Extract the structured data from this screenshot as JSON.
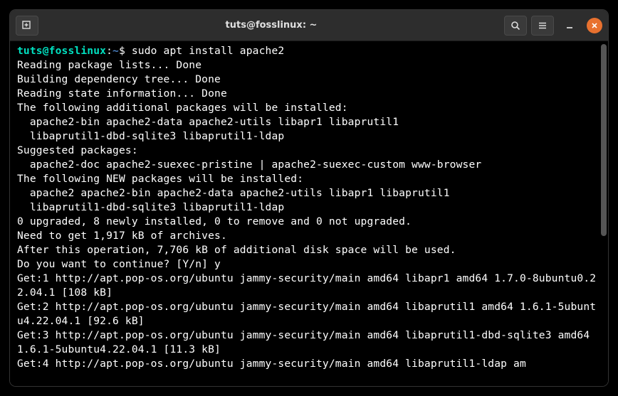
{
  "titlebar": {
    "title": "tuts@fosslinux: ~"
  },
  "prompt": {
    "user_host": "tuts@fosslinux",
    "colon": ":",
    "path": "~",
    "dollar": "$ "
  },
  "command": "sudo apt install apache2",
  "output": "Reading package lists... Done\nBuilding dependency tree... Done\nReading state information... Done\nThe following additional packages will be installed:\n  apache2-bin apache2-data apache2-utils libapr1 libaprutil1\n  libaprutil1-dbd-sqlite3 libaprutil1-ldap\nSuggested packages:\n  apache2-doc apache2-suexec-pristine | apache2-suexec-custom www-browser\nThe following NEW packages will be installed:\n  apache2 apache2-bin apache2-data apache2-utils libapr1 libaprutil1\n  libaprutil1-dbd-sqlite3 libaprutil1-ldap\n0 upgraded, 8 newly installed, 0 to remove and 0 not upgraded.\nNeed to get 1,917 kB of archives.\nAfter this operation, 7,706 kB of additional disk space will be used.\nDo you want to continue? [Y/n] y\nGet:1 http://apt.pop-os.org/ubuntu jammy-security/main amd64 libapr1 amd64 1.7.0-8ubuntu0.22.04.1 [108 kB]\nGet:2 http://apt.pop-os.org/ubuntu jammy-security/main amd64 libaprutil1 amd64 1.6.1-5ubuntu4.22.04.1 [92.6 kB]\nGet:3 http://apt.pop-os.org/ubuntu jammy-security/main amd64 libaprutil1-dbd-sqlite3 amd64 1.6.1-5ubuntu4.22.04.1 [11.3 kB]\nGet:4 http://apt.pop-os.org/ubuntu jammy-security/main amd64 libaprutil1-ldap am"
}
